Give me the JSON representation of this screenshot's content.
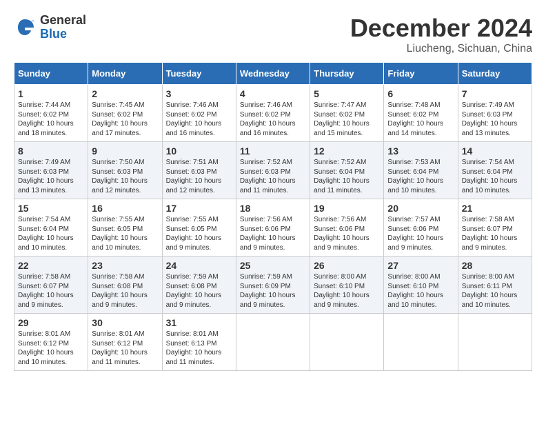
{
  "header": {
    "logo_general": "General",
    "logo_blue": "Blue",
    "month_title": "December 2024",
    "location": "Liucheng, Sichuan, China"
  },
  "calendar": {
    "days_of_week": [
      "Sunday",
      "Monday",
      "Tuesday",
      "Wednesday",
      "Thursday",
      "Friday",
      "Saturday"
    ],
    "weeks": [
      [
        {
          "day": "",
          "info": ""
        },
        {
          "day": "2",
          "info": "Sunrise: 7:45 AM\nSunset: 6:02 PM\nDaylight: 10 hours\nand 17 minutes."
        },
        {
          "day": "3",
          "info": "Sunrise: 7:46 AM\nSunset: 6:02 PM\nDaylight: 10 hours\nand 16 minutes."
        },
        {
          "day": "4",
          "info": "Sunrise: 7:46 AM\nSunset: 6:02 PM\nDaylight: 10 hours\nand 16 minutes."
        },
        {
          "day": "5",
          "info": "Sunrise: 7:47 AM\nSunset: 6:02 PM\nDaylight: 10 hours\nand 15 minutes."
        },
        {
          "day": "6",
          "info": "Sunrise: 7:48 AM\nSunset: 6:02 PM\nDaylight: 10 hours\nand 14 minutes."
        },
        {
          "day": "7",
          "info": "Sunrise: 7:49 AM\nSunset: 6:03 PM\nDaylight: 10 hours\nand 13 minutes."
        }
      ],
      [
        {
          "day": "1",
          "info": "Sunrise: 7:44 AM\nSunset: 6:02 PM\nDaylight: 10 hours\nand 18 minutes."
        },
        {
          "day": "",
          "info": ""
        },
        {
          "day": "",
          "info": ""
        },
        {
          "day": "",
          "info": ""
        },
        {
          "day": "",
          "info": ""
        },
        {
          "day": "",
          "info": ""
        },
        {
          "day": "",
          "info": ""
        }
      ],
      [
        {
          "day": "8",
          "info": "Sunrise: 7:49 AM\nSunset: 6:03 PM\nDaylight: 10 hours\nand 13 minutes."
        },
        {
          "day": "9",
          "info": "Sunrise: 7:50 AM\nSunset: 6:03 PM\nDaylight: 10 hours\nand 12 minutes."
        },
        {
          "day": "10",
          "info": "Sunrise: 7:51 AM\nSunset: 6:03 PM\nDaylight: 10 hours\nand 12 minutes."
        },
        {
          "day": "11",
          "info": "Sunrise: 7:52 AM\nSunset: 6:03 PM\nDaylight: 10 hours\nand 11 minutes."
        },
        {
          "day": "12",
          "info": "Sunrise: 7:52 AM\nSunset: 6:04 PM\nDaylight: 10 hours\nand 11 minutes."
        },
        {
          "day": "13",
          "info": "Sunrise: 7:53 AM\nSunset: 6:04 PM\nDaylight: 10 hours\nand 10 minutes."
        },
        {
          "day": "14",
          "info": "Sunrise: 7:54 AM\nSunset: 6:04 PM\nDaylight: 10 hours\nand 10 minutes."
        }
      ],
      [
        {
          "day": "15",
          "info": "Sunrise: 7:54 AM\nSunset: 6:04 PM\nDaylight: 10 hours\nand 10 minutes."
        },
        {
          "day": "16",
          "info": "Sunrise: 7:55 AM\nSunset: 6:05 PM\nDaylight: 10 hours\nand 10 minutes."
        },
        {
          "day": "17",
          "info": "Sunrise: 7:55 AM\nSunset: 6:05 PM\nDaylight: 10 hours\nand 9 minutes."
        },
        {
          "day": "18",
          "info": "Sunrise: 7:56 AM\nSunset: 6:06 PM\nDaylight: 10 hours\nand 9 minutes."
        },
        {
          "day": "19",
          "info": "Sunrise: 7:56 AM\nSunset: 6:06 PM\nDaylight: 10 hours\nand 9 minutes."
        },
        {
          "day": "20",
          "info": "Sunrise: 7:57 AM\nSunset: 6:06 PM\nDaylight: 10 hours\nand 9 minutes."
        },
        {
          "day": "21",
          "info": "Sunrise: 7:58 AM\nSunset: 6:07 PM\nDaylight: 10 hours\nand 9 minutes."
        }
      ],
      [
        {
          "day": "22",
          "info": "Sunrise: 7:58 AM\nSunset: 6:07 PM\nDaylight: 10 hours\nand 9 minutes."
        },
        {
          "day": "23",
          "info": "Sunrise: 7:58 AM\nSunset: 6:08 PM\nDaylight: 10 hours\nand 9 minutes."
        },
        {
          "day": "24",
          "info": "Sunrise: 7:59 AM\nSunset: 6:08 PM\nDaylight: 10 hours\nand 9 minutes."
        },
        {
          "day": "25",
          "info": "Sunrise: 7:59 AM\nSunset: 6:09 PM\nDaylight: 10 hours\nand 9 minutes."
        },
        {
          "day": "26",
          "info": "Sunrise: 8:00 AM\nSunset: 6:10 PM\nDaylight: 10 hours\nand 9 minutes."
        },
        {
          "day": "27",
          "info": "Sunrise: 8:00 AM\nSunset: 6:10 PM\nDaylight: 10 hours\nand 10 minutes."
        },
        {
          "day": "28",
          "info": "Sunrise: 8:00 AM\nSunset: 6:11 PM\nDaylight: 10 hours\nand 10 minutes."
        }
      ],
      [
        {
          "day": "29",
          "info": "Sunrise: 8:01 AM\nSunset: 6:12 PM\nDaylight: 10 hours\nand 10 minutes."
        },
        {
          "day": "30",
          "info": "Sunrise: 8:01 AM\nSunset: 6:12 PM\nDaylight: 10 hours\nand 11 minutes."
        },
        {
          "day": "31",
          "info": "Sunrise: 8:01 AM\nSunset: 6:13 PM\nDaylight: 10 hours\nand 11 minutes."
        },
        {
          "day": "",
          "info": ""
        },
        {
          "day": "",
          "info": ""
        },
        {
          "day": "",
          "info": ""
        },
        {
          "day": "",
          "info": ""
        }
      ]
    ]
  }
}
